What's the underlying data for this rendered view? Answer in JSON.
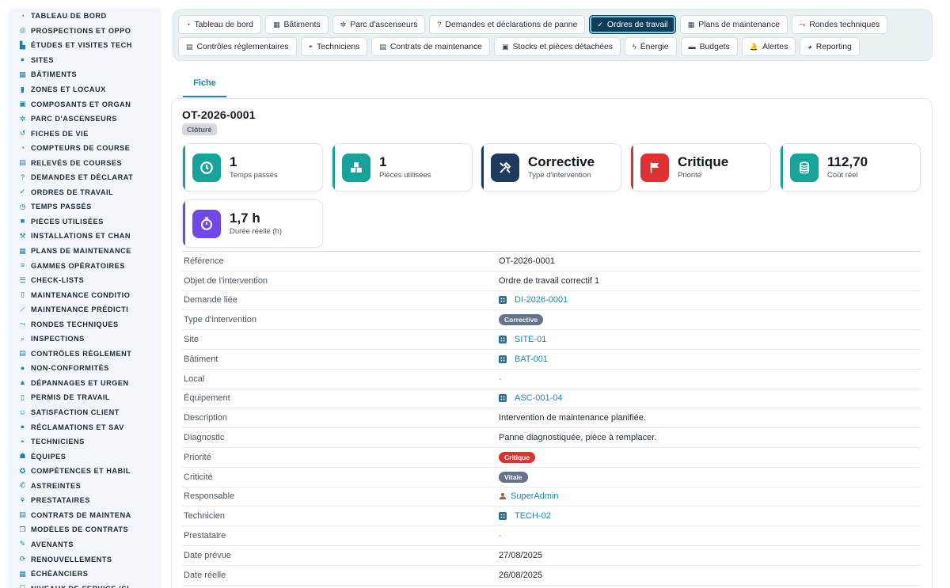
{
  "sidebar": {
    "items": [
      {
        "label": "TABLEAU DE BORD",
        "icon": "gauge-icon"
      },
      {
        "label": "PROSPECTIONS ET OPPO",
        "icon": "target-icon"
      },
      {
        "label": "ÉTUDES ET VISITES TECH",
        "icon": "ruler-icon"
      },
      {
        "label": "SITES",
        "icon": "map-pin-icon"
      },
      {
        "label": "BÂTIMENTS",
        "icon": "building-icon"
      },
      {
        "label": "ZONES ET LOCAUX",
        "icon": "door-icon"
      },
      {
        "label": "COMPOSANTS ET ORGAN",
        "icon": "cubes-icon"
      },
      {
        "label": "PARC D'ASCENSEURS",
        "icon": "cogs-icon"
      },
      {
        "label": "FICHES DE VIE",
        "icon": "history-icon"
      },
      {
        "label": "COMPTEURS DE COURSE",
        "icon": "gauge-icon"
      },
      {
        "label": "RELEVÉS DE COURSES",
        "icon": "clipboard-icon"
      },
      {
        "label": "DEMANDES ET DÉCLARAT",
        "icon": "question-icon"
      },
      {
        "label": "ORDRES DE TRAVAIL",
        "icon": "clipboard-check-icon"
      },
      {
        "label": "TEMPS PASSÉS",
        "icon": "clock-icon"
      },
      {
        "label": "PIÈCES UTILISÉES",
        "icon": "box-icon"
      },
      {
        "label": "INSTALLATIONS ET CHAN",
        "icon": "hammer-icon"
      },
      {
        "label": "PLANS DE MAINTENANCE",
        "icon": "calendar-icon"
      },
      {
        "label": "GAMMES OPÉRATOIRES",
        "icon": "list-icon"
      },
      {
        "label": "CHECK-LISTS",
        "icon": "list-check-icon"
      },
      {
        "label": "MAINTENANCE CONDITIO",
        "icon": "thermometer-icon"
      },
      {
        "label": "MAINTENANCE PRÉDICTI",
        "icon": "chart-line-icon"
      },
      {
        "label": "RONDES TECHNIQUES",
        "icon": "route-icon"
      },
      {
        "label": "INSPECTIONS",
        "icon": "search-icon"
      },
      {
        "label": "CONTRÔLES RÉGLEMENT",
        "icon": "clipboard-icon"
      },
      {
        "label": "NON-CONFORMITÉS",
        "icon": "alert-circle-icon"
      },
      {
        "label": "DÉPANNAGES ET URGEN",
        "icon": "warning-icon"
      },
      {
        "label": "PERMIS DE TRAVAIL",
        "icon": "file-icon"
      },
      {
        "label": "SATISFACTION CLIENT",
        "icon": "smile-icon"
      },
      {
        "label": "RÉCLAMATIONS ET SAV",
        "icon": "comment-icon"
      },
      {
        "label": "TECHNICIENS",
        "icon": "hardhat-icon"
      },
      {
        "label": "ÉQUIPES",
        "icon": "users-icon"
      },
      {
        "label": "COMPÉTENCES ET HABIL",
        "icon": "certificate-icon"
      },
      {
        "label": "ASTREINTES",
        "icon": "phone-icon"
      },
      {
        "label": "PRESTATAIRES",
        "icon": "handshake-icon"
      },
      {
        "label": "CONTRATS DE MAINTENA",
        "icon": "file-contract-icon"
      },
      {
        "label": "MODÈLES DE CONTRATS",
        "icon": "copy-icon"
      },
      {
        "label": "AVENANTS",
        "icon": "pen-icon"
      },
      {
        "label": "RENOUVELLEMENTS",
        "icon": "refresh-icon"
      },
      {
        "label": "ÉCHÉANCIERS",
        "icon": "calendar-icon"
      },
      {
        "label": "NIVEAUX DE SERVICE (SL",
        "icon": "shield-icon"
      }
    ]
  },
  "topnav": {
    "row1": [
      {
        "label": "Tableau de bord",
        "icon": "gauge-icon"
      },
      {
        "label": "Bâtiments",
        "icon": "building-icon"
      },
      {
        "label": "Parc d'ascenseurs",
        "icon": "cogs-icon"
      },
      {
        "label": "Demandes et déclarations de panne",
        "icon": "question-icon"
      },
      {
        "label": "Ordres de travail",
        "icon": "clipboard-check-icon",
        "active": true
      },
      {
        "label": "Plans de maintenance",
        "icon": "calendar-icon"
      },
      {
        "label": "Rondes techniques",
        "icon": "route-icon"
      }
    ],
    "row2": [
      {
        "label": "Contrôles réglementaires",
        "icon": "clipboard-icon"
      },
      {
        "label": "Techniciens",
        "icon": "hardhat-icon"
      },
      {
        "label": "Contrats de maintenance",
        "icon": "file-contract-icon"
      },
      {
        "label": "Stocks et pièces détachées",
        "icon": "cubes-icon"
      },
      {
        "label": "Énergie",
        "icon": "bolt-icon"
      },
      {
        "label": "Budgets",
        "icon": "money-icon"
      },
      {
        "label": "Alertes",
        "icon": "bell-icon"
      },
      {
        "label": "Reporting",
        "icon": "pie-chart-icon"
      }
    ]
  },
  "tab": {
    "label": "Fiche"
  },
  "record": {
    "title": "OT-2026-0001",
    "status": "Clôturé"
  },
  "stats": [
    {
      "value": "1",
      "label": "Temps passés",
      "icon": "clock-icon",
      "color": "#15a39a"
    },
    {
      "value": "1",
      "label": "Pièces utilisées",
      "icon": "boxes-icon",
      "color": "#15a39a"
    },
    {
      "value": "Corrective",
      "label": "Type d'intervention",
      "icon": "tools-icon",
      "color": "#1e3a5f"
    },
    {
      "value": "Critique",
      "label": "Priorité",
      "icon": "flag-icon",
      "color": "#e03131"
    },
    {
      "value": "112,70",
      "label": "Coût réel",
      "icon": "coins-icon",
      "color": "#15a39a"
    },
    {
      "value": "1,7 h",
      "label": "Durée réelle (h)",
      "icon": "stopwatch-icon",
      "color": "#7048e8"
    }
  ],
  "details": [
    {
      "label": "Référence",
      "value": "OT-2026-0001",
      "kind": "text"
    },
    {
      "label": "Objet de l'intervention",
      "value": "Ordre de travail correctif 1",
      "kind": "text"
    },
    {
      "label": "Demande liée",
      "value": "DI-2026-0001",
      "kind": "link"
    },
    {
      "label": "Type d'intervention",
      "value": "Corrective",
      "kind": "pill",
      "color": "#64748b"
    },
    {
      "label": "Site",
      "value": "SITE-01",
      "kind": "link"
    },
    {
      "label": "Bâtiment",
      "value": "BAT-001",
      "kind": "link"
    },
    {
      "label": "Local",
      "value": "-",
      "kind": "empty"
    },
    {
      "label": "Équipement",
      "value": "ASC-001-04",
      "kind": "link"
    },
    {
      "label": "Description",
      "value": "Intervention de maintenance planifiée.",
      "kind": "text"
    },
    {
      "label": "Diagnostic",
      "value": "Panne diagnostiquée, pièce à remplacer.",
      "kind": "text"
    },
    {
      "label": "Priorité",
      "value": "Critique",
      "kind": "pill",
      "color": "#e03131"
    },
    {
      "label": "Criticité",
      "value": "Vitale",
      "kind": "pill",
      "color": "#64748b"
    },
    {
      "label": "Responsable",
      "value": "SuperAdmin",
      "kind": "user"
    },
    {
      "label": "Technicien",
      "value": "TECH-02",
      "kind": "link"
    },
    {
      "label": "Prestataire",
      "value": "-",
      "kind": "empty"
    },
    {
      "label": "Date prévue",
      "value": "27/08/2025",
      "kind": "text"
    },
    {
      "label": "Date réelle",
      "value": "26/08/2025",
      "kind": "text"
    }
  ]
}
